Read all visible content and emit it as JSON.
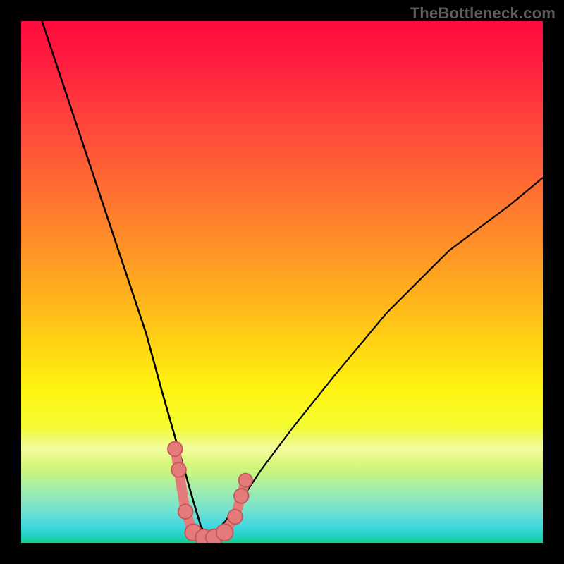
{
  "watermark": "TheBottleneck.com",
  "colors": {
    "background": "#000000",
    "curve_stroke": "#000000",
    "marker_fill": "#e47a7a",
    "marker_stroke": "#c45858"
  },
  "chart_data": {
    "type": "line",
    "title": "",
    "xlabel": "",
    "ylabel": "",
    "xlim": [
      0,
      100
    ],
    "ylim": [
      0,
      100
    ],
    "grid": false,
    "legend": false,
    "description": "V-shaped bottleneck curve on a red-to-green vertical gradient. Y encodes bottleneck severity (top = ~100% bottleneck, bottom = 0%). The minimum (optimal match) is around x ≈ 36 where the curve dips to the green zone. A cluster of pink markers sits at the trough.",
    "series": [
      {
        "name": "left-branch",
        "x": [
          4,
          8,
          12,
          16,
          20,
          24,
          27,
          29,
          31,
          33,
          34.5,
          36
        ],
        "y": [
          100,
          88,
          76,
          64,
          52,
          40,
          29,
          22,
          15,
          8,
          3,
          1
        ]
      },
      {
        "name": "right-branch",
        "x": [
          36,
          39,
          42,
          46,
          52,
          60,
          70,
          82,
          94,
          100
        ],
        "y": [
          1,
          4,
          8,
          14,
          22,
          32,
          44,
          56,
          65,
          70
        ]
      }
    ],
    "markers": [
      {
        "x": 29.5,
        "y": 18,
        "r": 1.4
      },
      {
        "x": 30.2,
        "y": 14,
        "r": 1.4
      },
      {
        "x": 31.5,
        "y": 6,
        "r": 1.4
      },
      {
        "x": 33.0,
        "y": 2,
        "r": 1.6
      },
      {
        "x": 35.0,
        "y": 1,
        "r": 1.6
      },
      {
        "x": 37.0,
        "y": 1,
        "r": 1.6
      },
      {
        "x": 39.0,
        "y": 2,
        "r": 1.6
      },
      {
        "x": 41.0,
        "y": 5,
        "r": 1.4
      },
      {
        "x": 42.2,
        "y": 9,
        "r": 1.4
      },
      {
        "x": 43.0,
        "y": 12,
        "r": 1.3
      }
    ]
  }
}
